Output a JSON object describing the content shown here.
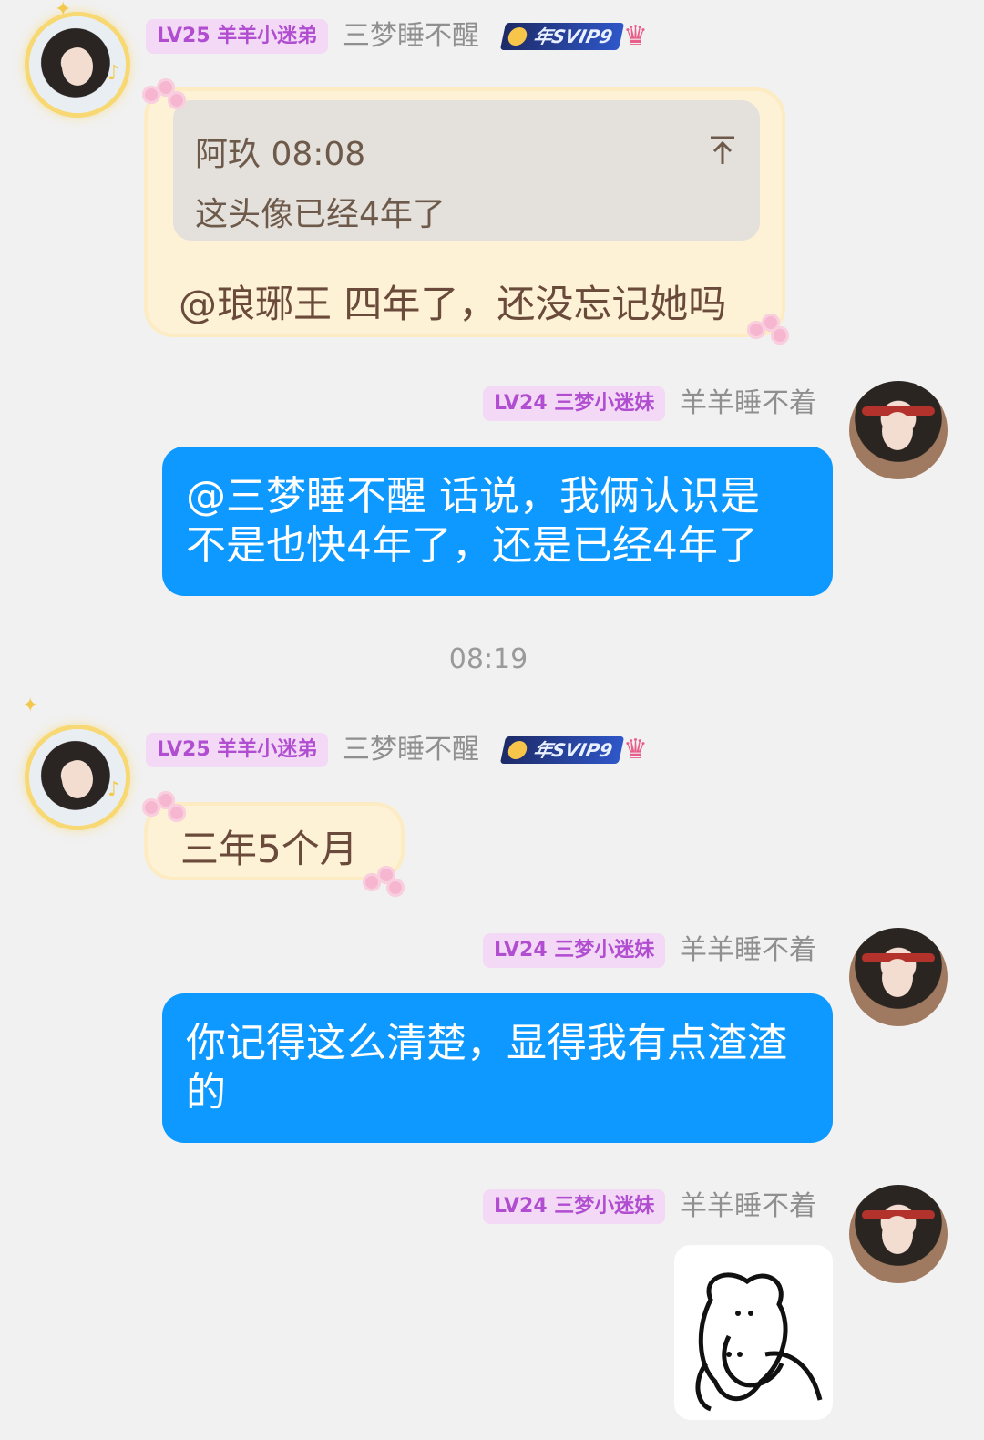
{
  "messages": [
    {
      "sender": {
        "level_badge": "LV25 羊羊小迷弟",
        "nickname": "三梦睡不醒",
        "vip_badge": "年SVIP9"
      },
      "quote": {
        "author_time": "阿玖 08:08",
        "text": "这头像已经4年了"
      },
      "text": "@琅琊王 四年了，还没忘记她吗"
    },
    {
      "sender": {
        "level_badge": "LV24 三梦小迷妹",
        "nickname": "羊羊睡不着"
      },
      "text_lines": [
        "@三梦睡不醒 话说，我俩认识是",
        "不是也快4年了，还是已经4年了"
      ]
    },
    {
      "time_divider": "08:19"
    },
    {
      "sender": {
        "level_badge": "LV25 羊羊小迷弟",
        "nickname": "三梦睡不醒",
        "vip_badge": "年SVIP9"
      },
      "text": "三年5个月"
    },
    {
      "sender": {
        "level_badge": "LV24 三梦小迷妹",
        "nickname": "羊羊睡不着"
      },
      "text_lines": [
        "你记得这么清楚，显得我有点渣渣",
        "的"
      ]
    },
    {
      "sender": {
        "level_badge": "LV24 三梦小迷妹",
        "nickname": "羊羊睡不着"
      },
      "sticker": "hugging-bear-sticker"
    }
  ],
  "colors": {
    "background": "#f1f1f1",
    "blue_bubble": "#0d99ff",
    "level_badge_bg": "#f3d9f5",
    "level_badge_text": "#b04dd0",
    "fancy_bubble": "#fdf1d6"
  }
}
